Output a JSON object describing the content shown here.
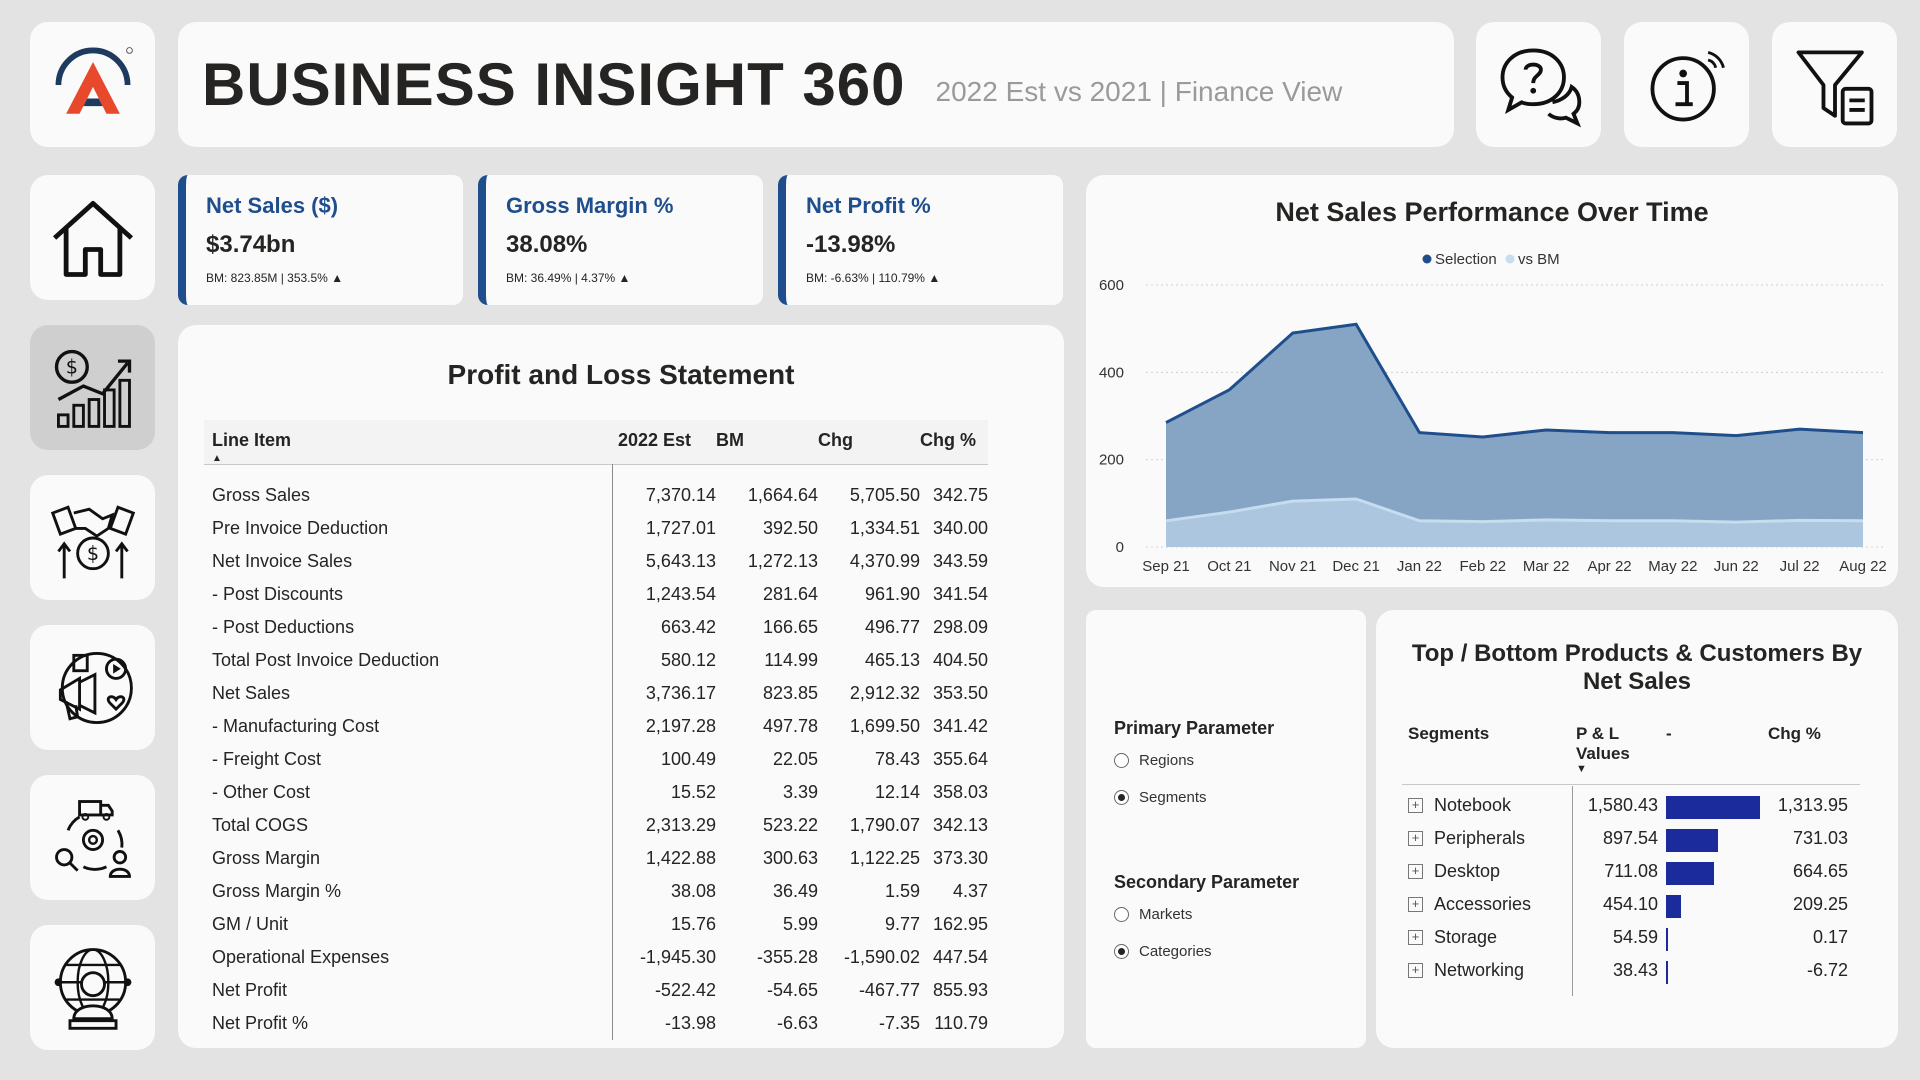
{
  "header": {
    "title": "BUSINESS INSIGHT 360",
    "subtitle": "2022 Est vs 2021 | Finance View"
  },
  "toolbar": {
    "help": "help-chat-icon",
    "info": "info-icon",
    "filter": "filter-icon"
  },
  "sidebar": {
    "items": [
      {
        "icon": "home-icon"
      },
      {
        "icon": "finance-view-icon",
        "active": true
      },
      {
        "icon": "sales-view-icon"
      },
      {
        "icon": "marketing-view-icon"
      },
      {
        "icon": "supply-chain-view-icon"
      },
      {
        "icon": "executive-view-icon"
      }
    ]
  },
  "kpis": [
    {
      "label": "Net Sales ($)",
      "value": "$3.74bn",
      "sub": "BM: 823.85M | 353.5%",
      "trend": "▲"
    },
    {
      "label": "Gross Margin %",
      "value": "38.08%",
      "sub": "BM: 36.49% | 4.37%",
      "trend": "▲"
    },
    {
      "label": "Net Profit %",
      "value": "-13.98%",
      "sub": "BM: -6.63% | 110.79%",
      "trend": "▲"
    }
  ],
  "pl": {
    "title": "Profit and Loss Statement",
    "columns": [
      "Line Item",
      "2022 Est",
      "BM",
      "Chg",
      "Chg %"
    ],
    "sort_indicator": "▲",
    "rows": [
      [
        "Gross Sales",
        "7,370.14",
        "1,664.64",
        "5,705.50",
        "342.75"
      ],
      [
        "Pre Invoice Deduction",
        "1,727.01",
        "392.50",
        "1,334.51",
        "340.00"
      ],
      [
        "Net Invoice Sales",
        "5,643.13",
        "1,272.13",
        "4,370.99",
        "343.59"
      ],
      [
        "- Post Discounts",
        "1,243.54",
        "281.64",
        "961.90",
        "341.54"
      ],
      [
        "- Post Deductions",
        "663.42",
        "166.65",
        "496.77",
        "298.09"
      ],
      [
        "Total Post Invoice Deduction",
        "580.12",
        "114.99",
        "465.13",
        "404.50"
      ],
      [
        "Net Sales",
        "3,736.17",
        "823.85",
        "2,912.32",
        "353.50"
      ],
      [
        "- Manufacturing Cost",
        "2,197.28",
        "497.78",
        "1,699.50",
        "341.42"
      ],
      [
        "- Freight Cost",
        "100.49",
        "22.05",
        "78.43",
        "355.64"
      ],
      [
        "- Other Cost",
        "15.52",
        "3.39",
        "12.14",
        "358.03"
      ],
      [
        "Total COGS",
        "2,313.29",
        "523.22",
        "1,790.07",
        "342.13"
      ],
      [
        "Gross Margin",
        "1,422.88",
        "300.63",
        "1,122.25",
        "373.30"
      ],
      [
        "Gross Margin %",
        "38.08",
        "36.49",
        "1.59",
        "4.37"
      ],
      [
        "GM / Unit",
        "15.76",
        "5.99",
        "9.77",
        "162.95"
      ],
      [
        "Operational Expenses",
        "-1,945.30",
        "-355.28",
        "-1,590.02",
        "447.54"
      ],
      [
        "Net Profit",
        "-522.42",
        "-54.65",
        "-467.77",
        "855.93"
      ],
      [
        "Net Profit %",
        "-13.98",
        "-6.63",
        "-7.35",
        "110.79"
      ]
    ]
  },
  "chart_data": {
    "type": "area",
    "title": "Net Sales Performance Over Time",
    "categories": [
      "Sep 21",
      "Oct 21",
      "Nov 21",
      "Dec 21",
      "Jan 22",
      "Feb 22",
      "Mar 22",
      "Apr 22",
      "May 22",
      "Jun 22",
      "Jul 22",
      "Aug 22"
    ],
    "series": [
      {
        "name": "Selection",
        "color": "#1f4e8c",
        "values": [
          285,
          360,
          490,
          510,
          262,
          252,
          268,
          262,
          262,
          255,
          270,
          262
        ]
      },
      {
        "name": "vs BM",
        "color": "#c6dcef",
        "values": [
          60,
          80,
          105,
          110,
          60,
          58,
          62,
          60,
          60,
          57,
          61,
          60
        ]
      }
    ],
    "ylim": [
      0,
      600
    ],
    "yticks": [
      0,
      200,
      400,
      600
    ],
    "legend": "top-center",
    "grid": true
  },
  "params": {
    "primary": {
      "title": "Primary Parameter",
      "options": [
        {
          "label": "Regions",
          "selected": false
        },
        {
          "label": "Segments",
          "selected": true
        }
      ]
    },
    "secondary": {
      "title": "Secondary Parameter",
      "options": [
        {
          "label": "Markets",
          "selected": false
        },
        {
          "label": "Categories",
          "selected": true
        }
      ]
    }
  },
  "topbottom": {
    "title_line1": "Top / Bottom Products & Customers By",
    "title_line2": "Net Sales",
    "columns": {
      "segments": "Segments",
      "pl_line1": "P & L",
      "pl_line2": "Values",
      "dash": "-",
      "chg": "Chg %"
    },
    "sort_indicator": "▼",
    "rows": [
      {
        "segment": "Notebook",
        "pl": "1,580.43",
        "chg": "1,313.95",
        "bar": 1313.95
      },
      {
        "segment": "Peripherals",
        "pl": "897.54",
        "chg": "731.03",
        "bar": 731.03
      },
      {
        "segment": "Desktop",
        "pl": "711.08",
        "chg": "664.65",
        "bar": 664.65
      },
      {
        "segment": "Accessories",
        "pl": "454.10",
        "chg": "209.25",
        "bar": 209.25
      },
      {
        "segment": "Storage",
        "pl": "54.59",
        "chg": "0.17",
        "bar": 0.17
      },
      {
        "segment": "Networking",
        "pl": "38.43",
        "chg": "-6.72",
        "bar": -6.72
      }
    ]
  }
}
